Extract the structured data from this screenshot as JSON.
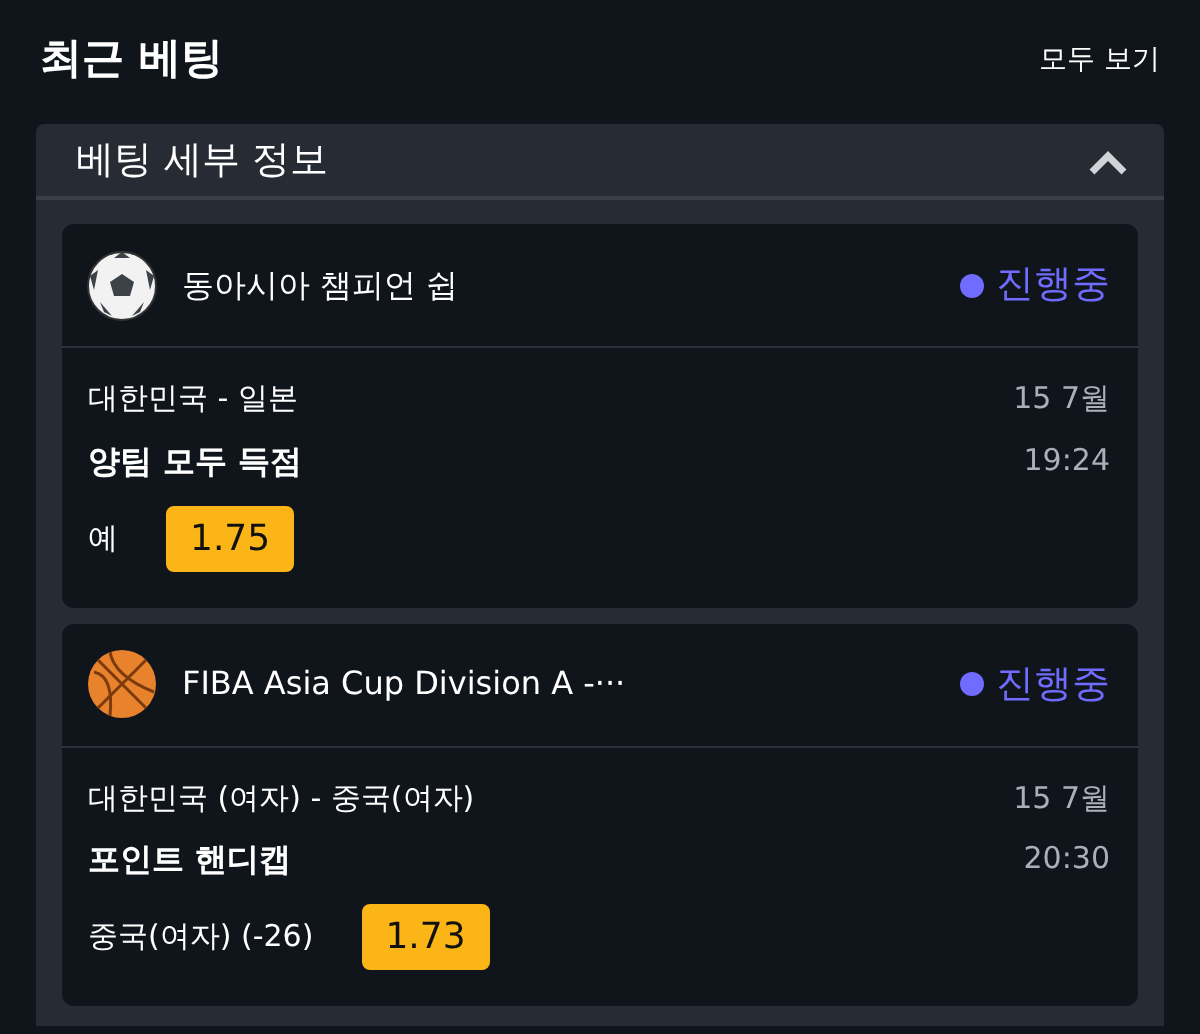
{
  "header": {
    "title": "최근 베팅",
    "link": "모두 보기"
  },
  "panel": {
    "title": "베팅 세부 정보",
    "expanded": true
  },
  "bets": [
    {
      "kind": "soccer",
      "league": "동아시아 챔피언 쉽",
      "status": "진행중",
      "color": "#6f6cff",
      "match": "대한민국 - 일본",
      "date": "15 7월",
      "market": "양팀 모두 득점",
      "time": "19:24",
      "selection": "예",
      "odds": "1.75"
    },
    {
      "kind": "basketball",
      "league": "FIBA Asia Cup Division A -···",
      "status": "진행중",
      "color": "#6f6cff",
      "match": "대한민국 (여자) - 중국(여자)",
      "date": "15 7월",
      "market": "포인트 핸디캡",
      "time": "20:30",
      "selection": "중국(여자) (-26)",
      "odds": "1.73"
    }
  ]
}
